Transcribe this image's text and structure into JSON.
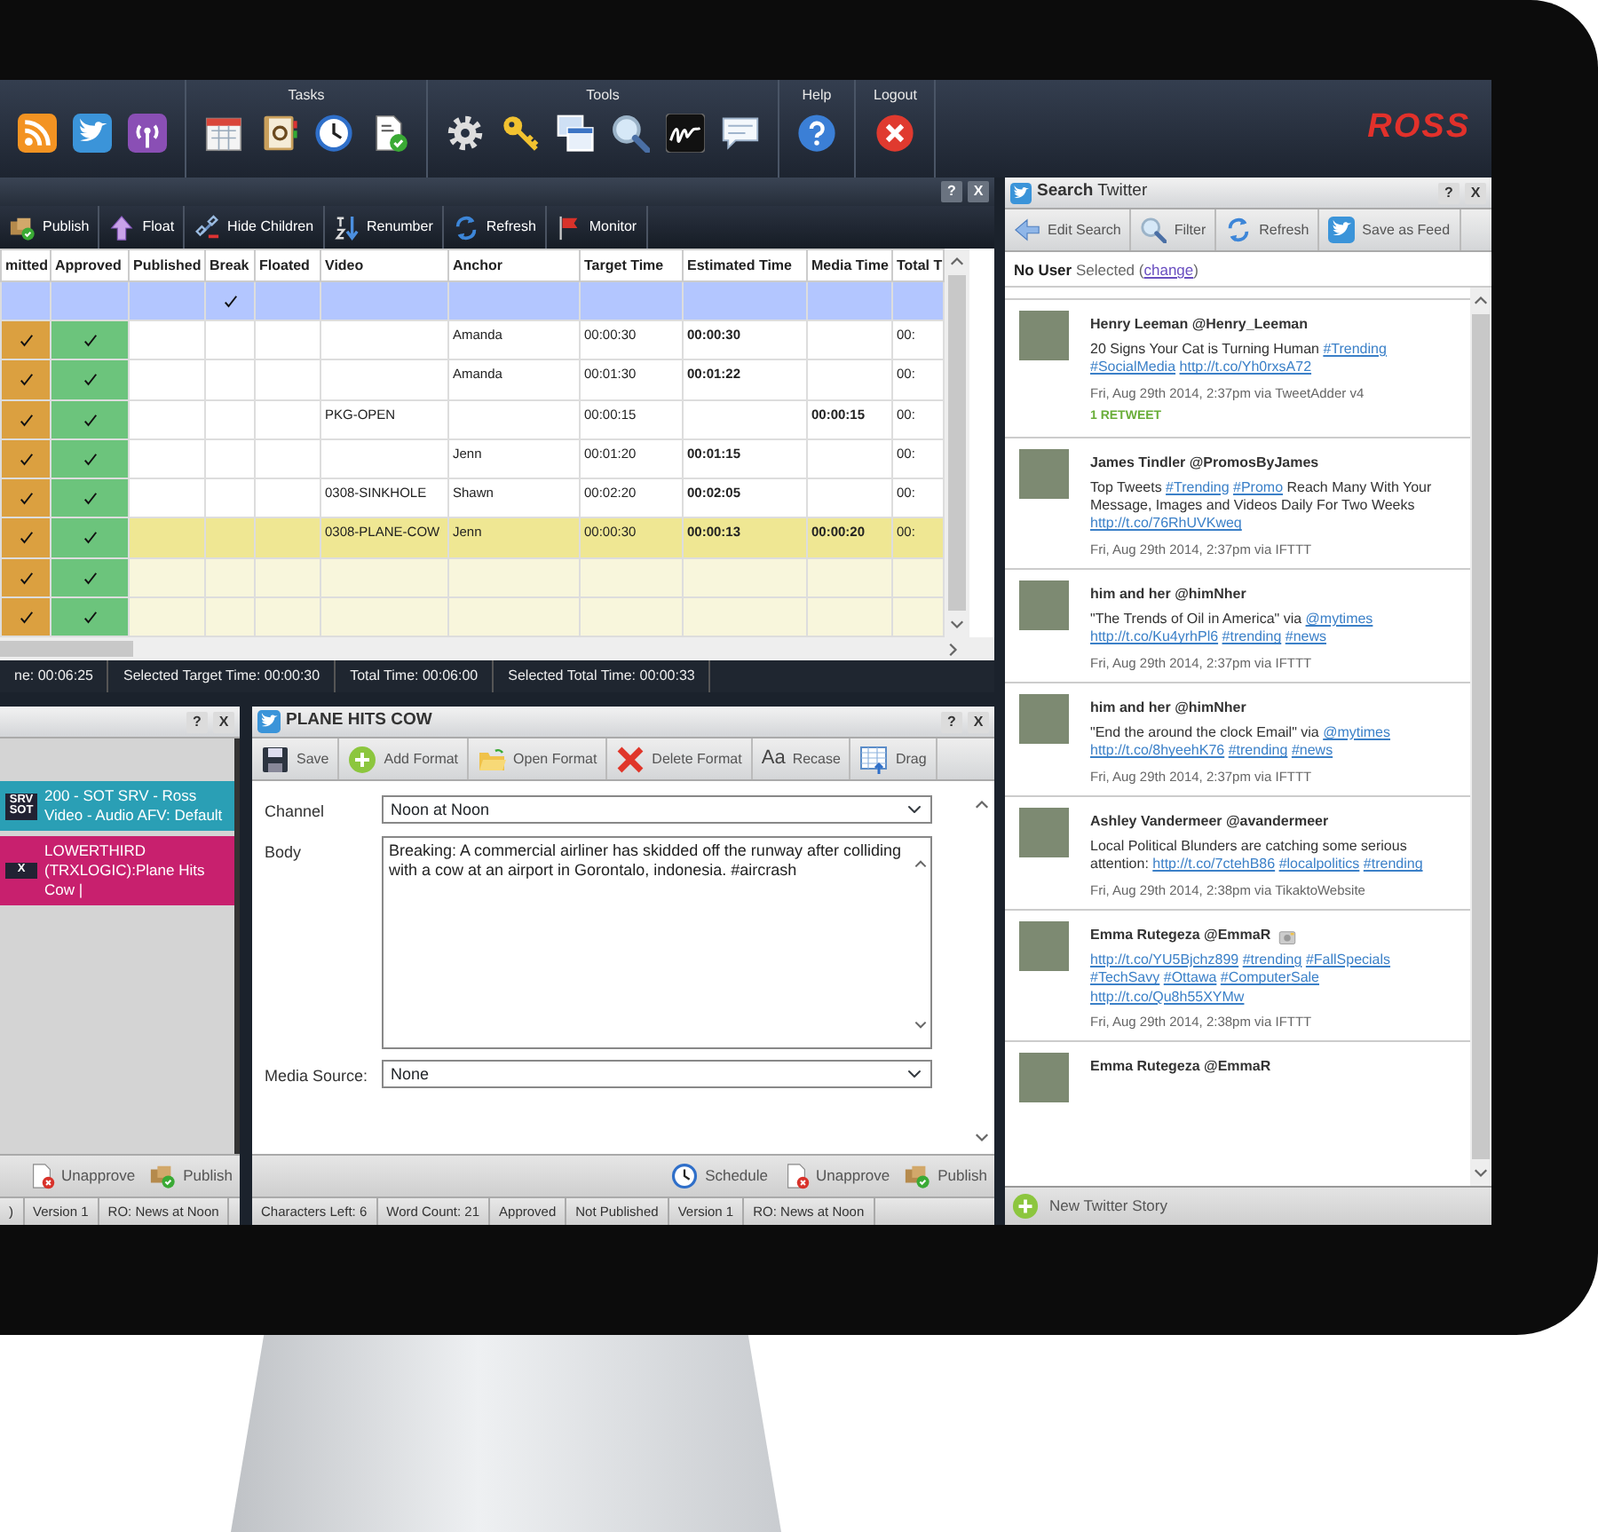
{
  "toolbar": {
    "groups": [
      {
        "title": "Tasks"
      },
      {
        "title": "Tools"
      },
      {
        "title": "Help"
      },
      {
        "title": "Logout"
      }
    ],
    "logo": "ROSS"
  },
  "rundown": {
    "controls": [
      "?",
      "X"
    ],
    "toolbar": [
      "Publish",
      "Float",
      "Hide Children",
      "Renumber",
      "Refresh",
      "Monitor"
    ],
    "columns": [
      "mitted",
      "Approved",
      "Published",
      "Break",
      "Floated",
      "Video",
      "Anchor",
      "Target Time",
      "Estimated Time",
      "Media Time",
      "Total T"
    ],
    "rows": [
      {
        "kind": "plain",
        "selected": true,
        "submitted": false,
        "approved": false,
        "break": true
      },
      {
        "kind": "plain",
        "selected": false,
        "submitted": true,
        "approved": true,
        "break": false,
        "anchor": "Amanda",
        "target": "00:00:30",
        "estimated": "00:00:30",
        "total": "00:"
      },
      {
        "kind": "plain",
        "selected": false,
        "submitted": true,
        "approved": true,
        "break": false,
        "anchor": "Amanda",
        "target": "00:01:30",
        "estimated": "00:01:22",
        "total": "00:"
      },
      {
        "kind": "plain",
        "selected": false,
        "submitted": true,
        "approved": true,
        "break": false,
        "video": "PKG-OPEN",
        "target": "00:00:15",
        "media": "00:00:15",
        "total": "00:"
      },
      {
        "kind": "plain",
        "selected": false,
        "submitted": true,
        "approved": true,
        "break": false,
        "anchor": "Jenn",
        "target": "00:01:20",
        "estimated": "00:01:15",
        "total": "00:"
      },
      {
        "kind": "plain",
        "selected": false,
        "submitted": true,
        "approved": true,
        "break": false,
        "video": "0308-SINKHOLE",
        "anchor": "Shawn",
        "target": "00:02:20",
        "estimated": "00:02:05",
        "total": "00:"
      },
      {
        "kind": "feature",
        "selected": false,
        "submitted": true,
        "approved": true,
        "break": false,
        "video": "0308-PLANE-COW",
        "anchor": "Jenn",
        "target": "00:00:30",
        "estimated": "00:00:13",
        "media": "00:00:20",
        "total": "00:"
      },
      {
        "kind": "pending",
        "selected": false,
        "submitted": true,
        "approved": true,
        "break": false
      },
      {
        "kind": "pending",
        "selected": false,
        "submitted": true,
        "approved": true,
        "break": false
      }
    ],
    "status": [
      "ne: 00:06:25",
      "Selected Target Time: 00:00:30",
      "Total Time: 00:06:00",
      "Selected Total Time: 00:00:33"
    ]
  },
  "queue": {
    "controls": [
      "?",
      "X"
    ],
    "items": [
      {
        "badge": "SRV SOT",
        "text": "200 - SOT SRV - Ross Video - Audio AFV: Default",
        "color": "#2a9fb5"
      },
      {
        "badge": "X",
        "text": "LOWERTHIRD (TRXLOGIC):Plane Hits Cow |",
        "color": "#c8206e"
      }
    ],
    "actions": [
      "Unapprove",
      "Publish"
    ],
    "status": [
      ")",
      "Version 1",
      "RO: News at Noon"
    ]
  },
  "story": {
    "title": "PLANE HITS COW",
    "controls": [
      "?",
      "X"
    ],
    "toolbar": [
      {
        "label": "Save"
      },
      {
        "label": "Add Format"
      },
      {
        "label": "Open Format"
      },
      {
        "label": "Delete Format"
      },
      {
        "label": "Recase",
        "glyph": "Aa"
      },
      {
        "label": "Drag"
      }
    ],
    "fields": [
      {
        "kind": "select",
        "label": "Channel",
        "value": "Noon at Noon"
      },
      {
        "kind": "textarea",
        "label": "Body",
        "value": "Breaking: A commercial airliner has skidded off the runway after colliding with a cow at an airport in Gorontalo, indonesia. #aircrash"
      },
      {
        "kind": "select",
        "label": "Media Source:",
        "value": "None"
      }
    ],
    "actions": [
      "Schedule",
      "Unapprove",
      "Publish"
    ],
    "status": [
      "Characters Left: 6",
      "Word Count: 21",
      "Approved",
      "Not Published",
      "Version 1",
      "RO: News at Noon"
    ]
  },
  "twitter": {
    "title": "**Search** Twitter",
    "controls": [
      "?",
      "X"
    ],
    "toolbar": [
      "Edit Search",
      "Filter",
      "Refresh",
      "Save as Feed"
    ],
    "user": {
      "prefix": "**No User** Selected (",
      "link": "change",
      "suffix": ")"
    },
    "tweets": [
      {
        "author": "Henry Leeman @Henry_Leeman",
        "segments": [
          {
            "kind": "plain",
            "text": "20 Signs Your Cat is Turning Human"
          },
          {
            "kind": "link",
            "text": "#Trending"
          },
          {
            "kind": "link",
            "text": "#SocialMedia"
          },
          {
            "kind": "link",
            "text": "http://t.co/Yh0rxsA72"
          }
        ],
        "meta": "Fri, Aug 29th 2014, 2:37pm via TweetAdder v4",
        "retweets": "1 RETWEET"
      },
      {
        "author": "James Tindler @PromosByJames",
        "segments": [
          {
            "kind": "plain",
            "text": "Top Tweets"
          },
          {
            "kind": "link",
            "text": "#Trending"
          },
          {
            "kind": "link",
            "text": "#Promo"
          },
          {
            "kind": "plain",
            "text": "Reach Many With Your Message, Images and Videos Daily For Two Weeks"
          },
          {
            "kind": "link",
            "text": "http://t.co/76RhUVKweq"
          }
        ],
        "meta": "Fri, Aug 29th 2014, 2:37pm via IFTTT"
      },
      {
        "author": "him and her @himNher",
        "segments": [
          {
            "kind": "plain",
            "text": "\"The Trends of Oil in America\" via"
          },
          {
            "kind": "link",
            "text": "@mytimes"
          },
          {
            "kind": "link",
            "text": "http://t.co/Ku4yrhPl6"
          },
          {
            "kind": "link",
            "text": "#trending"
          },
          {
            "kind": "link",
            "text": "#news"
          }
        ],
        "meta": "Fri, Aug 29th 2014, 2:37pm via IFTTT"
      },
      {
        "author": "him and her @himNher",
        "segments": [
          {
            "kind": "plain",
            "text": "\"End the around the clock Email\" via"
          },
          {
            "kind": "link",
            "text": "@mytimes"
          },
          {
            "kind": "link",
            "text": "http://t.co/8hyeehK76"
          },
          {
            "kind": "link",
            "text": "#trending"
          },
          {
            "kind": "link",
            "text": "#news"
          }
        ],
        "meta": "Fri, Aug 29th 2014, 2:37pm via IFTTT"
      },
      {
        "author": "Ashley Vandermeer @avandermeer",
        "segments": [
          {
            "kind": "plain",
            "text": "Local Political Blunders are catching some serious attention:"
          },
          {
            "kind": "link",
            "text": "http://t.co/7ctehB86"
          },
          {
            "kind": "link",
            "text": "#localpolitics"
          },
          {
            "kind": "link",
            "text": "#trending"
          }
        ],
        "meta": "Fri, Aug 29th 2014, 2:38pm via TikaktoWebsite"
      },
      {
        "author": "Emma Rutegeza @EmmaR",
        "has_photo": true,
        "segments": [
          {
            "kind": "link",
            "text": "http://t.co/YU5Bjchz899"
          },
          {
            "kind": "link",
            "text": "#trending"
          },
          {
            "kind": "link",
            "text": "#FallSpecials"
          },
          {
            "kind": "link",
            "text": "#TechSavy"
          },
          {
            "kind": "link",
            "text": "#Ottawa"
          },
          {
            "kind": "link",
            "text": "#ComputerSale"
          },
          {
            "kind": "link",
            "text": "http://t.co/Qu8h55XYMw"
          }
        ],
        "meta": "Fri, Aug 29th 2014, 2:38pm via IFTTT"
      },
      {
        "author": "Emma Rutegeza @EmmaR"
      }
    ],
    "footer": "New Twitter Story"
  }
}
